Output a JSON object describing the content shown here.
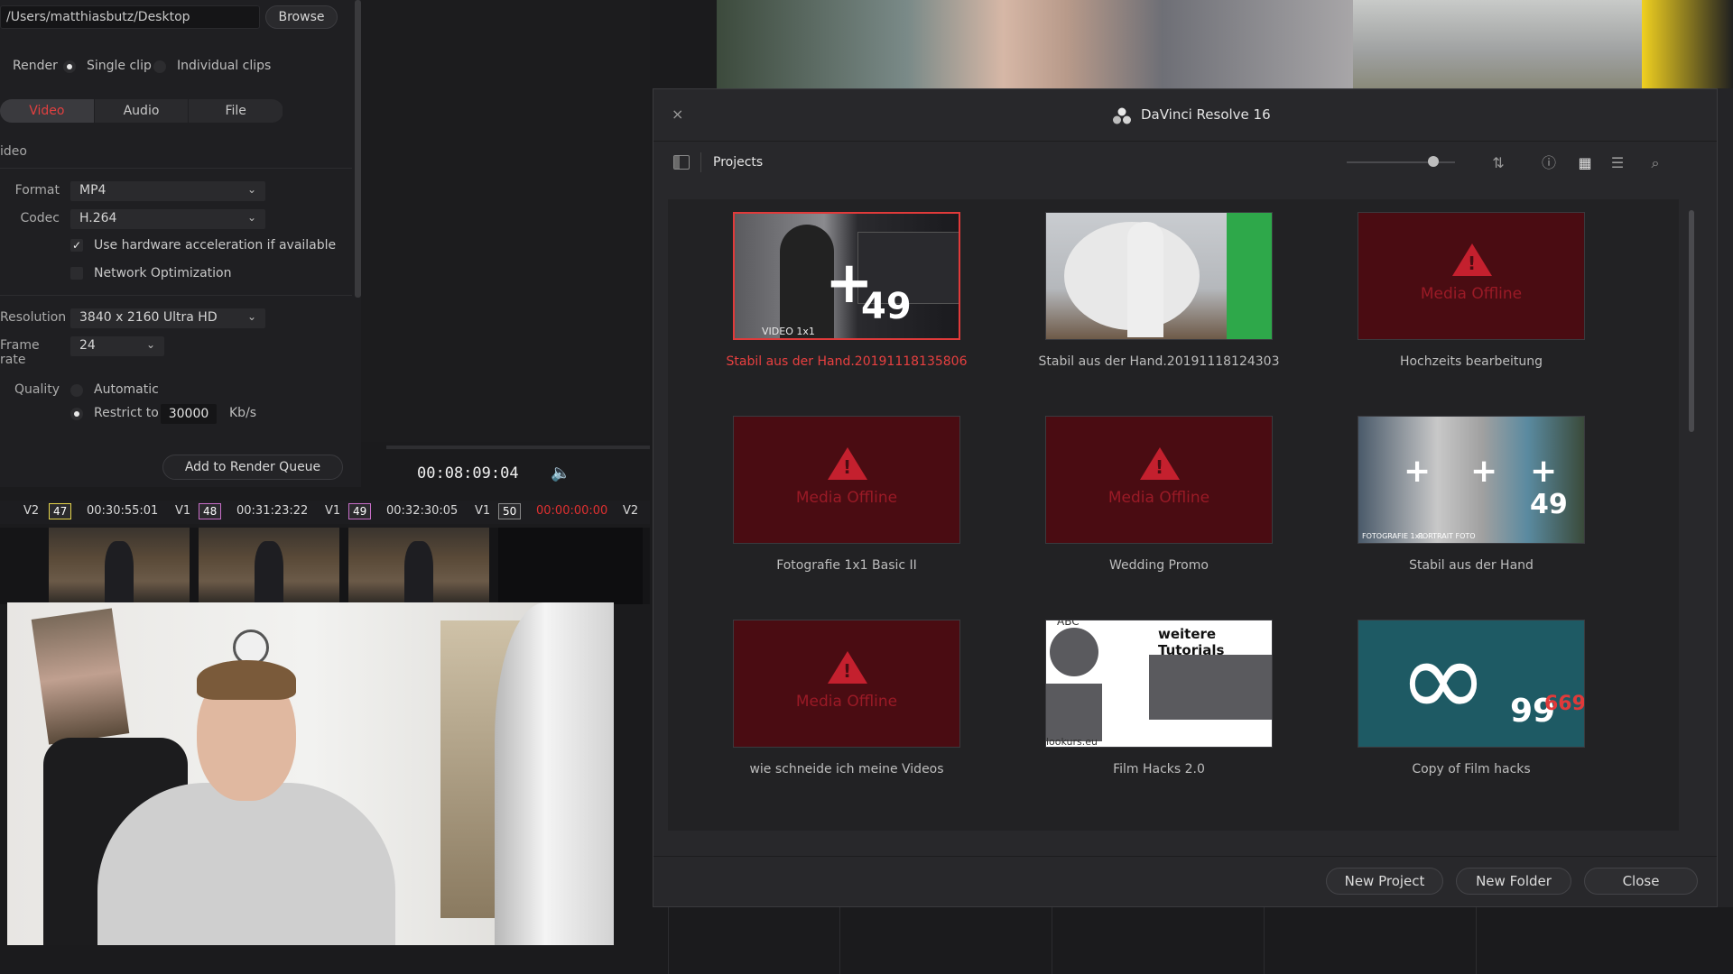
{
  "render": {
    "path": "/Users/matthiasbutz/Desktop",
    "browse_label": "Browse",
    "render_label": "Render",
    "single_clip": "Single clip",
    "individual_clips": "Individual clips",
    "tabs": [
      "Video",
      "Audio",
      "File"
    ],
    "section_title": "ideo",
    "format_label": "Format",
    "format_value": "MP4",
    "codec_label": "Codec",
    "codec_value": "H.264",
    "hw_accel": "Use hardware acceleration if available",
    "network_opt": "Network Optimization",
    "resolution_label": "Resolution",
    "resolution_value": "3840 x 2160 Ultra HD",
    "framerate_label": "Frame rate",
    "framerate_value": "24",
    "quality_label": "Quality",
    "automatic": "Automatic",
    "restrict_to": "Restrict to",
    "bitrate": "30000",
    "bitrate_unit": "Kb/s",
    "add_to_queue": "Add to Render Queue"
  },
  "viewer": {
    "timecode": "00:08:09:04"
  },
  "timeline": {
    "clips": [
      {
        "track": "V2",
        "num": "47",
        "tc": "00:30:55:01"
      },
      {
        "track": "V1",
        "num": "48",
        "tc": "00:31:23:22"
      },
      {
        "track": "V1",
        "num": "49",
        "tc": "00:32:30:05"
      },
      {
        "track": "V1",
        "num": "50",
        "tc": "00:00:00:00"
      },
      {
        "track": "V2"
      }
    ]
  },
  "dialog": {
    "title": "DaVinci Resolve 16",
    "projects_label": "Projects",
    "offline_text": "Media Offline",
    "projects": [
      {
        "name": "Stabil aus der Hand.20191118135806",
        "vid_tag": "VIDEO 1x1",
        "num": "49"
      },
      {
        "name": "Stabil aus der Hand.20191118124303"
      },
      {
        "name": "Hochzeits bearbeitung"
      },
      {
        "name": "Fotografie 1x1 Basic II"
      },
      {
        "name": "Wedding Promo"
      },
      {
        "name": "Stabil aus der Hand",
        "tag1": "FOTOGRAFIE 1x1",
        "tag2": "PORTRAIT FOTO",
        "num": "49"
      },
      {
        "name": "wie schneide ich meine Videos"
      },
      {
        "name": "Film Hacks 2.0",
        "abc": "ABC",
        "tut_title": "weitere Tutorials",
        "url": "lookurs.eu"
      },
      {
        "name": "Copy of Film hacks",
        "num": "99",
        "num_small": "669"
      }
    ],
    "buttons": {
      "new_project": "New Project",
      "new_folder": "New Folder",
      "close": "Close"
    }
  }
}
